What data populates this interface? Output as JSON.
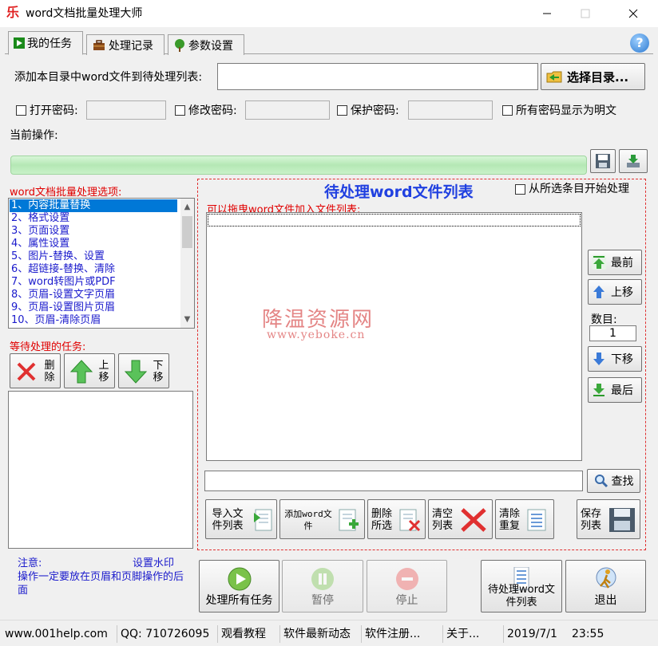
{
  "window": {
    "title": "word文档批量处理大师",
    "app_icon_glyph": "乐",
    "controls": [
      "minimize",
      "maximize",
      "close"
    ]
  },
  "tabs": [
    {
      "label": "我的任务",
      "icon": "play-icon",
      "active": true
    },
    {
      "label": "处理记录",
      "icon": "briefcase-icon",
      "active": false
    },
    {
      "label": "参数设置",
      "icon": "tree-icon",
      "active": false
    }
  ],
  "help_icon": "help-icon",
  "add_dir": {
    "label": "添加本目录中word文件到待处理列表:",
    "value": "",
    "button_label": "选择目录..."
  },
  "passwords": {
    "open_label": "打开密码:",
    "modify_label": "修改密码:",
    "protect_label": "保护密码:",
    "show_plain_label": "所有密码显示为明文"
  },
  "current_op": {
    "label": "当前操作:",
    "progress": 0
  },
  "options": {
    "label": "word文档批量处理选项:",
    "items": [
      "1、内容批量替换",
      "2、格式设置",
      "3、页面设置",
      "4、属性设置",
      "5、图片-替换、设置",
      "6、超链接-替换、清除",
      "7、word转图片或PDF",
      "8、页眉-设置文字页眉",
      "9、页眉-设置图片页眉",
      "10、页眉-清除页眉"
    ],
    "selected_index": 0
  },
  "pending": {
    "label": "等待处理的任务:",
    "delete_label": "删除",
    "up_label": "上移",
    "down_label": "下移"
  },
  "file_panel": {
    "title": "待处理word文件列表",
    "start_from_selected": "从所选条目开始处理",
    "drag_hint": "可以拖曳word文件加入文件列表:",
    "watermark": "降温资源网",
    "watermark_url": "www.yeboke.cn",
    "side_buttons": [
      "最前",
      "上移",
      "下移",
      "最后"
    ],
    "count_label": "数目:",
    "count_value": "1",
    "search_value": "",
    "search_button": "查找",
    "bottom_buttons": [
      {
        "label": "导入文件列表"
      },
      {
        "label": "添加word文件"
      },
      {
        "label": "删除所选"
      },
      {
        "label": "清空列表"
      },
      {
        "label": "清除重复"
      },
      {
        "label": "保存列表"
      }
    ]
  },
  "note": {
    "prefix": "注意:",
    "link": "设置水印",
    "text": "操作一定要放在页眉和页脚操作的后面"
  },
  "actions": {
    "process_all": "处理所有任务",
    "pause": "暂停",
    "stop": "停止",
    "pending_list": "待处理word文件列表",
    "exit": "退出"
  },
  "statusbar": {
    "site": "www.001help.com",
    "qq": "QQ: 710726095",
    "tutorial": "观看教程",
    "news": "软件最新动态",
    "register": "软件注册...",
    "about": "关于...",
    "date": "2019/7/1",
    "time": "23:55"
  },
  "colors": {
    "accent_blue": "#2040e0",
    "alert_red": "#e00000",
    "selection": "#0078d7",
    "progress_green": "#b4e8b4"
  }
}
